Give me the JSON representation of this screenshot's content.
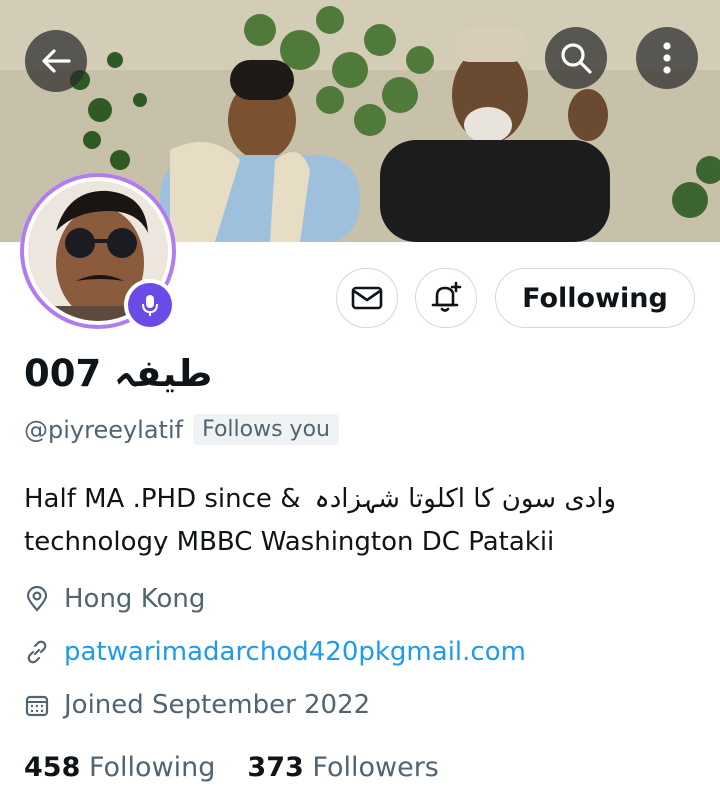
{
  "profile": {
    "display_name": "طيفہ 007",
    "handle": "@piyreeylatif",
    "follows_you": "Follows you",
    "bio_urdu": "وادی سون کا اکلوتا شہزادہ",
    "bio_line1": "Half MA .PHD since &",
    "bio_line2": "technology MBBC Washington DC Patakii",
    "location": "Hong Kong",
    "website": "patwarimadarchod420pkgmail.com",
    "joined": "Joined September 2022",
    "following_count": "458",
    "following_label": "Following",
    "followers_count": "373",
    "followers_label": "Followers"
  },
  "actions": {
    "follow_state_label": "Following"
  },
  "icons": {
    "back": "arrow-left-icon",
    "search": "search-icon",
    "more": "more-vertical-icon",
    "message": "envelope-icon",
    "notify": "bell-plus-icon",
    "voice": "microphone-icon",
    "location": "location-pin-icon",
    "website": "link-icon",
    "joined": "calendar-icon"
  },
  "colors": {
    "accent_link": "#1d9bf0",
    "secondary_text": "#536471",
    "avatar_ring": "#b17cf0",
    "voice_badge": "#6b4be8"
  }
}
